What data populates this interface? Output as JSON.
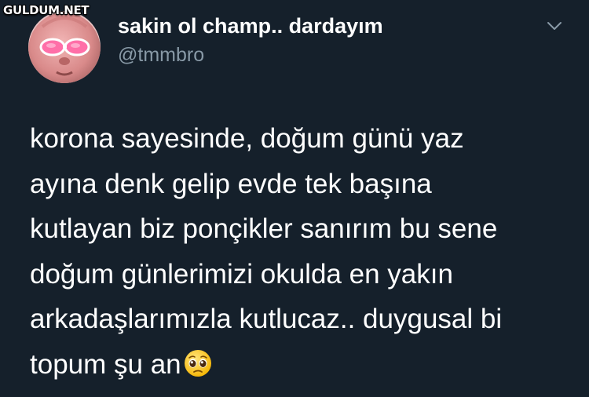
{
  "watermark": "GULDUM.NET",
  "tweet": {
    "display_name": "sakin ol champ.. dardayım",
    "handle": "@tmmbro",
    "lines": [
      "korona sayesinde, doğum günü yaz",
      "ayına denk gelip evde tek başına",
      "kutlayan biz ponçikler sanırım bu sene",
      "doğum günlerimizi okulda en yakın",
      "arkadaşlarımızla kutlucaz.. duygusal bi",
      "topum şu an"
    ],
    "emoji": "pleading-face"
  },
  "icons": {
    "menu": "chevron-down-icon",
    "avatar": "avatar-pink-face-sunglasses"
  },
  "colors": {
    "background": "#15202b",
    "text_primary": "#ffffff",
    "text_secondary": "#8899a6"
  }
}
